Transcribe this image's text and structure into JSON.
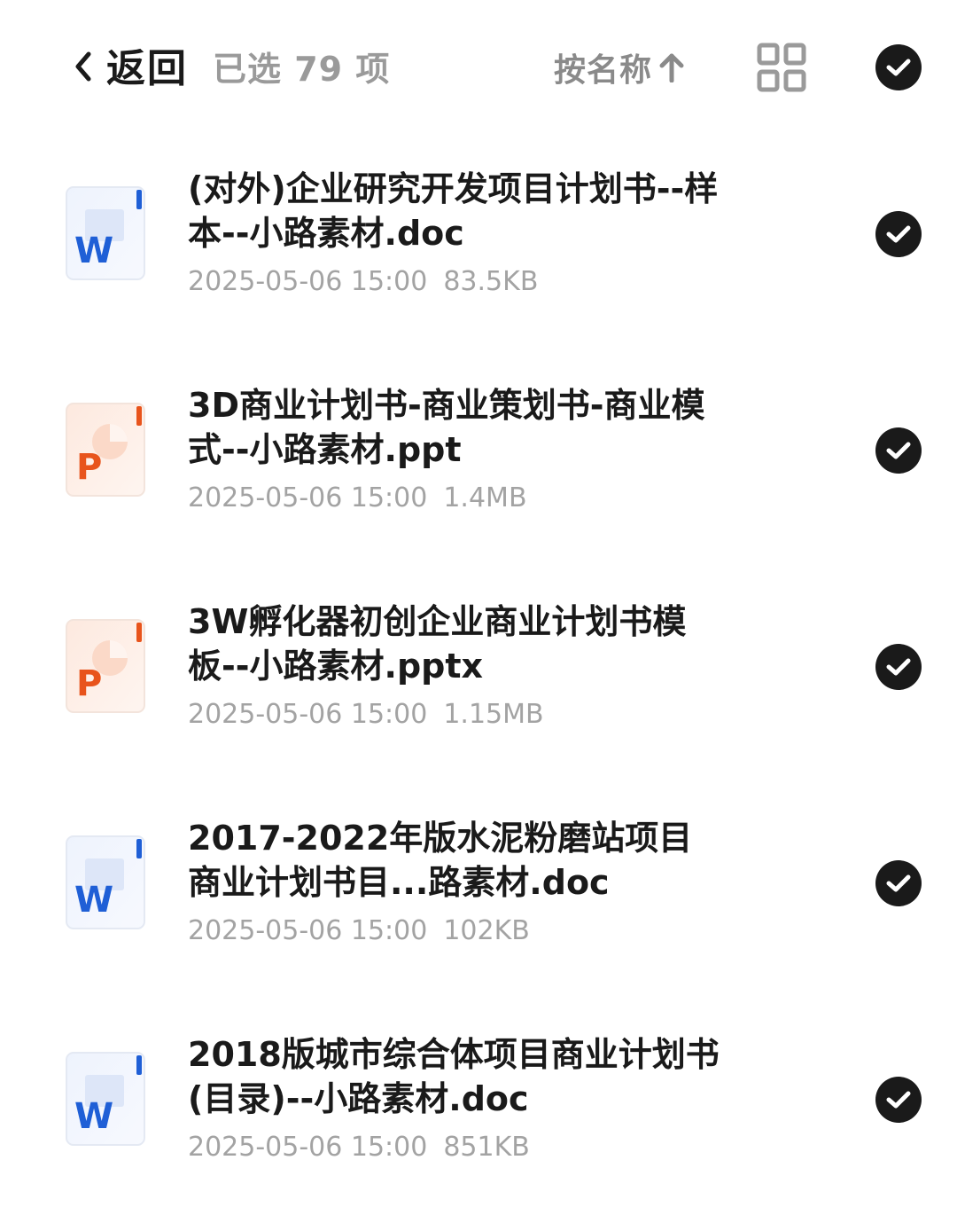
{
  "header": {
    "back_label": "返回",
    "selected_count": "已选 79 项",
    "sort_label": "按名称",
    "icons": {
      "back": "chevron-left-icon",
      "sort": "arrow-up-icon",
      "view": "grid-view-icon",
      "select_all": "check-circle-icon"
    }
  },
  "files": [
    {
      "name": "(对外)企业研究开发项目计划书--样本--小路素材.doc",
      "date": "2025-05-06 15:00",
      "size": "83.5KB",
      "type": "word",
      "icon_letter": "W",
      "selected": true
    },
    {
      "name": "3D商业计划书-商业策划书-商业模式--小路素材.ppt",
      "date": "2025-05-06 15:00",
      "size": "1.4MB",
      "type": "ppt",
      "icon_letter": "P",
      "selected": true
    },
    {
      "name": "3W孵化器初创企业商业计划书模板--小路素材.pptx",
      "date": "2025-05-06 15:00",
      "size": "1.15MB",
      "type": "ppt",
      "icon_letter": "P",
      "selected": true
    },
    {
      "name": "2017-2022年版水泥粉磨站项目商业计划书目...路素材.doc",
      "date": "2025-05-06 15:00",
      "size": "102KB",
      "type": "word",
      "icon_letter": "W",
      "selected": true
    },
    {
      "name": "2018版城市综合体项目商业计划书(目录)--小路素材.doc",
      "date": "2025-05-06 15:00",
      "size": "851KB",
      "type": "word",
      "icon_letter": "W",
      "selected": true
    }
  ],
  "colors": {
    "word_accent": "#1f5fd6",
    "ppt_accent": "#e8541c",
    "check_bg": "#1a1a1a",
    "muted_text": "#a3a3a3"
  }
}
